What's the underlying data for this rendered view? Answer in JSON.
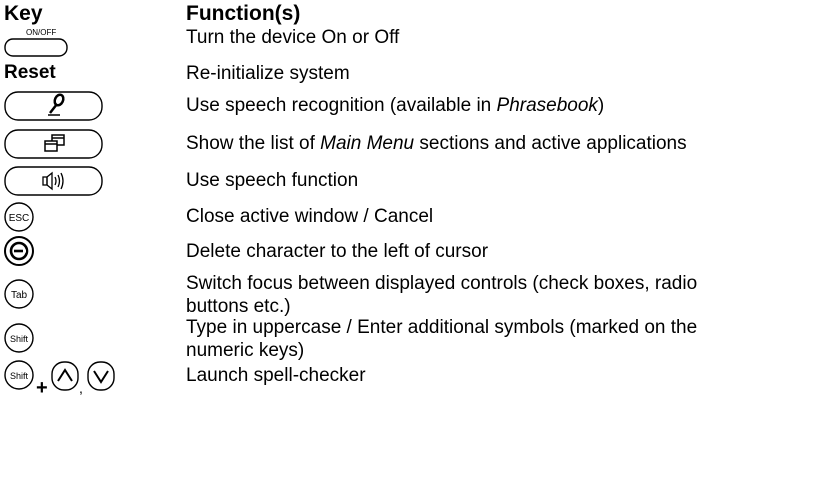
{
  "header": {
    "key": "Key",
    "function": "Function(s)"
  },
  "rows": [
    {
      "key_label": "ON/OFF",
      "function": "Turn the device On or Off"
    },
    {
      "key_label": "Reset",
      "function": "Re-initialize system"
    },
    {
      "key_icon": "microphone-icon",
      "function_before": "Use speech recognition (available in ",
      "function_em": "Phrasebook",
      "function_after": ")"
    },
    {
      "key_icon": "windows-icon",
      "function_before": "Show the list of ",
      "function_em": "Main Menu",
      "function_after": " sections and active applications"
    },
    {
      "key_icon": "speaker-icon",
      "function": "Use speech function"
    },
    {
      "key_label": "ESC",
      "function": "Close active window / Cancel"
    },
    {
      "key_icon": "backspace-icon",
      "function": "Delete character to the left of cursor"
    },
    {
      "key_label": "Tab",
      "function_line1": "Switch focus between displayed controls (check boxes, radio",
      "function_line2": "buttons etc.)"
    },
    {
      "key_label": "Shift",
      "function_line1": "Type in uppercase / Enter additional symbols (marked on the",
      "function_line2": "numeric keys)"
    },
    {
      "key_label": "Shift",
      "key_plus": "+",
      "key_comma": ",",
      "key_icons": [
        "up-arrow-icon",
        "down-arrow-icon"
      ],
      "function": "Launch spell-checker"
    }
  ]
}
